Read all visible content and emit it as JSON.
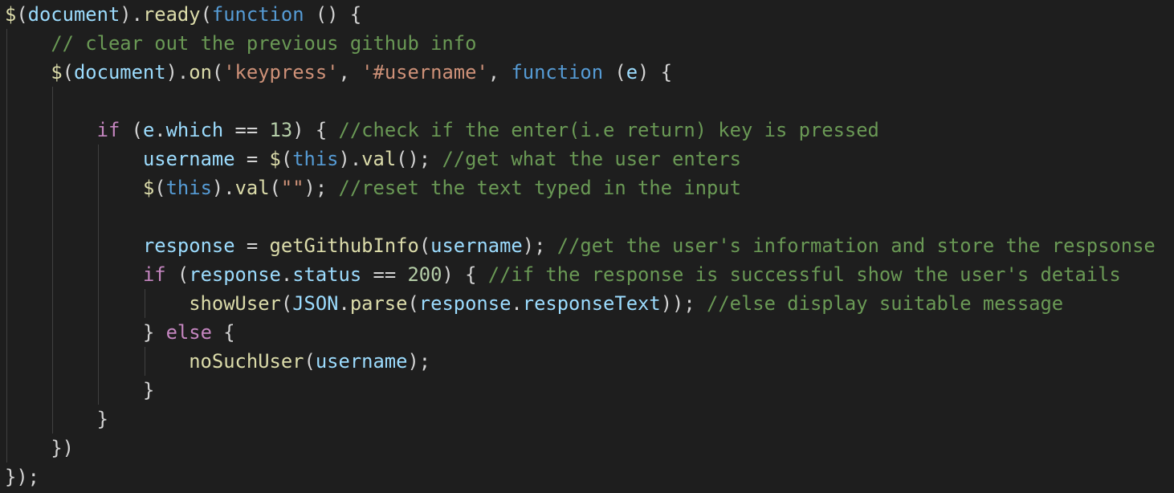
{
  "editor": {
    "theme_colors": {
      "background": "#1e1e1e",
      "default": "#d4d4d4",
      "function": "#dcdcaa",
      "variable": "#9cdcfe",
      "keyword": "#569cd6",
      "control": "#c586c0",
      "string": "#ce9178",
      "number": "#b5cea8",
      "comment": "#6a9955",
      "class": "#4ec9b0"
    },
    "lines": [
      {
        "tokens": [
          {
            "t": "$",
            "c": "func"
          },
          {
            "t": "(",
            "c": "default"
          },
          {
            "t": "document",
            "c": "var"
          },
          {
            "t": ").",
            "c": "default"
          },
          {
            "t": "ready",
            "c": "func"
          },
          {
            "t": "(",
            "c": "default"
          },
          {
            "t": "function",
            "c": "kw"
          },
          {
            "t": " () {",
            "c": "default"
          }
        ]
      },
      {
        "tokens": [
          {
            "t": "    ",
            "c": "default"
          },
          {
            "t": "// clear out the previous github info",
            "c": "comment"
          }
        ]
      },
      {
        "tokens": [
          {
            "t": "    ",
            "c": "default"
          },
          {
            "t": "$",
            "c": "func"
          },
          {
            "t": "(",
            "c": "default"
          },
          {
            "t": "document",
            "c": "var"
          },
          {
            "t": ").",
            "c": "default"
          },
          {
            "t": "on",
            "c": "func"
          },
          {
            "t": "(",
            "c": "default"
          },
          {
            "t": "'keypress'",
            "c": "str"
          },
          {
            "t": ", ",
            "c": "default"
          },
          {
            "t": "'#username'",
            "c": "str"
          },
          {
            "t": ", ",
            "c": "default"
          },
          {
            "t": "function",
            "c": "kw"
          },
          {
            "t": " (",
            "c": "default"
          },
          {
            "t": "e",
            "c": "var"
          },
          {
            "t": ") {",
            "c": "default"
          }
        ]
      },
      {
        "tokens": []
      },
      {
        "tokens": [
          {
            "t": "        ",
            "c": "default"
          },
          {
            "t": "if",
            "c": "ctrl"
          },
          {
            "t": " (",
            "c": "default"
          },
          {
            "t": "e",
            "c": "var"
          },
          {
            "t": ".",
            "c": "default"
          },
          {
            "t": "which",
            "c": "var"
          },
          {
            "t": " == ",
            "c": "default"
          },
          {
            "t": "13",
            "c": "num"
          },
          {
            "t": ") { ",
            "c": "default"
          },
          {
            "t": "//check if the enter(i.e return) key is pressed",
            "c": "comment"
          }
        ]
      },
      {
        "tokens": [
          {
            "t": "            ",
            "c": "default"
          },
          {
            "t": "username",
            "c": "var"
          },
          {
            "t": " = ",
            "c": "default"
          },
          {
            "t": "$",
            "c": "func"
          },
          {
            "t": "(",
            "c": "default"
          },
          {
            "t": "this",
            "c": "kw"
          },
          {
            "t": ").",
            "c": "default"
          },
          {
            "t": "val",
            "c": "func"
          },
          {
            "t": "(); ",
            "c": "default"
          },
          {
            "t": "//get what the user enters",
            "c": "comment"
          }
        ]
      },
      {
        "tokens": [
          {
            "t": "            ",
            "c": "default"
          },
          {
            "t": "$",
            "c": "func"
          },
          {
            "t": "(",
            "c": "default"
          },
          {
            "t": "this",
            "c": "kw"
          },
          {
            "t": ").",
            "c": "default"
          },
          {
            "t": "val",
            "c": "func"
          },
          {
            "t": "(",
            "c": "default"
          },
          {
            "t": "\"\"",
            "c": "str"
          },
          {
            "t": "); ",
            "c": "default"
          },
          {
            "t": "//reset the text typed in the input",
            "c": "comment"
          }
        ]
      },
      {
        "tokens": []
      },
      {
        "tokens": [
          {
            "t": "            ",
            "c": "default"
          },
          {
            "t": "response",
            "c": "var"
          },
          {
            "t": " = ",
            "c": "default"
          },
          {
            "t": "getGithubInfo",
            "c": "func"
          },
          {
            "t": "(",
            "c": "default"
          },
          {
            "t": "username",
            "c": "var"
          },
          {
            "t": "); ",
            "c": "default"
          },
          {
            "t": "//get the user's information and store the respsonse",
            "c": "comment"
          }
        ]
      },
      {
        "tokens": [
          {
            "t": "            ",
            "c": "default"
          },
          {
            "t": "if",
            "c": "ctrl"
          },
          {
            "t": " (",
            "c": "default"
          },
          {
            "t": "response",
            "c": "var"
          },
          {
            "t": ".",
            "c": "default"
          },
          {
            "t": "status",
            "c": "var"
          },
          {
            "t": " == ",
            "c": "default"
          },
          {
            "t": "200",
            "c": "num"
          },
          {
            "t": ") { ",
            "c": "default"
          },
          {
            "t": "//if the response is successful show the user's details",
            "c": "comment"
          }
        ]
      },
      {
        "tokens": [
          {
            "t": "                ",
            "c": "default"
          },
          {
            "t": "showUser",
            "c": "func"
          },
          {
            "t": "(",
            "c": "default"
          },
          {
            "t": "JSON",
            "c": "var"
          },
          {
            "t": ".",
            "c": "default"
          },
          {
            "t": "parse",
            "c": "func"
          },
          {
            "t": "(",
            "c": "default"
          },
          {
            "t": "response",
            "c": "var"
          },
          {
            "t": ".",
            "c": "default"
          },
          {
            "t": "responseText",
            "c": "var"
          },
          {
            "t": ")); ",
            "c": "default"
          },
          {
            "t": "//else display suitable message",
            "c": "comment"
          }
        ]
      },
      {
        "tokens": [
          {
            "t": "            ",
            "c": "default"
          },
          {
            "t": "} ",
            "c": "default"
          },
          {
            "t": "else",
            "c": "ctrl"
          },
          {
            "t": " {",
            "c": "default"
          }
        ]
      },
      {
        "tokens": [
          {
            "t": "                ",
            "c": "default"
          },
          {
            "t": "noSuchUser",
            "c": "func"
          },
          {
            "t": "(",
            "c": "default"
          },
          {
            "t": "username",
            "c": "var"
          },
          {
            "t": ");",
            "c": "default"
          }
        ]
      },
      {
        "tokens": [
          {
            "t": "            ",
            "c": "default"
          },
          {
            "t": "}",
            "c": "default"
          }
        ]
      },
      {
        "tokens": [
          {
            "t": "        ",
            "c": "default"
          },
          {
            "t": "}",
            "c": "default"
          }
        ]
      },
      {
        "tokens": [
          {
            "t": "    ",
            "c": "default"
          },
          {
            "t": "})",
            "c": "default"
          }
        ]
      },
      {
        "tokens": [
          {
            "t": "});",
            "c": "default"
          }
        ]
      }
    ]
  }
}
